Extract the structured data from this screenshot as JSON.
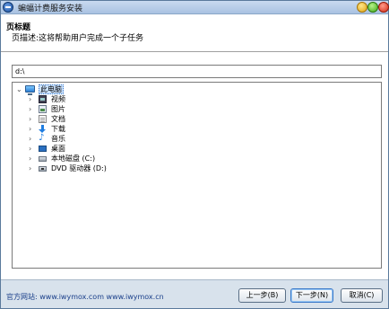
{
  "window": {
    "title": "蝙蝠计费服务安装"
  },
  "header": {
    "title": "页标题",
    "description": "页描述:这将帮助用户完成一个子任务"
  },
  "path_input": {
    "value": "d:\\"
  },
  "tree": {
    "root": {
      "label": "此电脑",
      "icon": "pc-icon",
      "expanded": true,
      "selected": true
    },
    "items": [
      {
        "label": "视频",
        "icon": "video-icon"
      },
      {
        "label": "图片",
        "icon": "pictures-icon"
      },
      {
        "label": "文档",
        "icon": "documents-icon"
      },
      {
        "label": "下载",
        "icon": "download-icon"
      },
      {
        "label": "音乐",
        "icon": "music-icon"
      },
      {
        "label": "桌面",
        "icon": "desktop-icon"
      },
      {
        "label": "本地磁盘 (C:)",
        "icon": "disk-icon"
      },
      {
        "label": "DVD 驱动器 (D:)",
        "icon": "dvd-icon"
      }
    ]
  },
  "footer": {
    "site_label": "官方网站:",
    "site_links": "www.iwymox.com www.iwymox.cn",
    "prev_label": "上一步(B)",
    "next_label": "下一步(N)",
    "cancel_label": "取消(C)"
  },
  "colors": {
    "selection_bg": "#cde4ff",
    "link": "#1a3f8a",
    "footer_bg": "#d8e2ec"
  }
}
